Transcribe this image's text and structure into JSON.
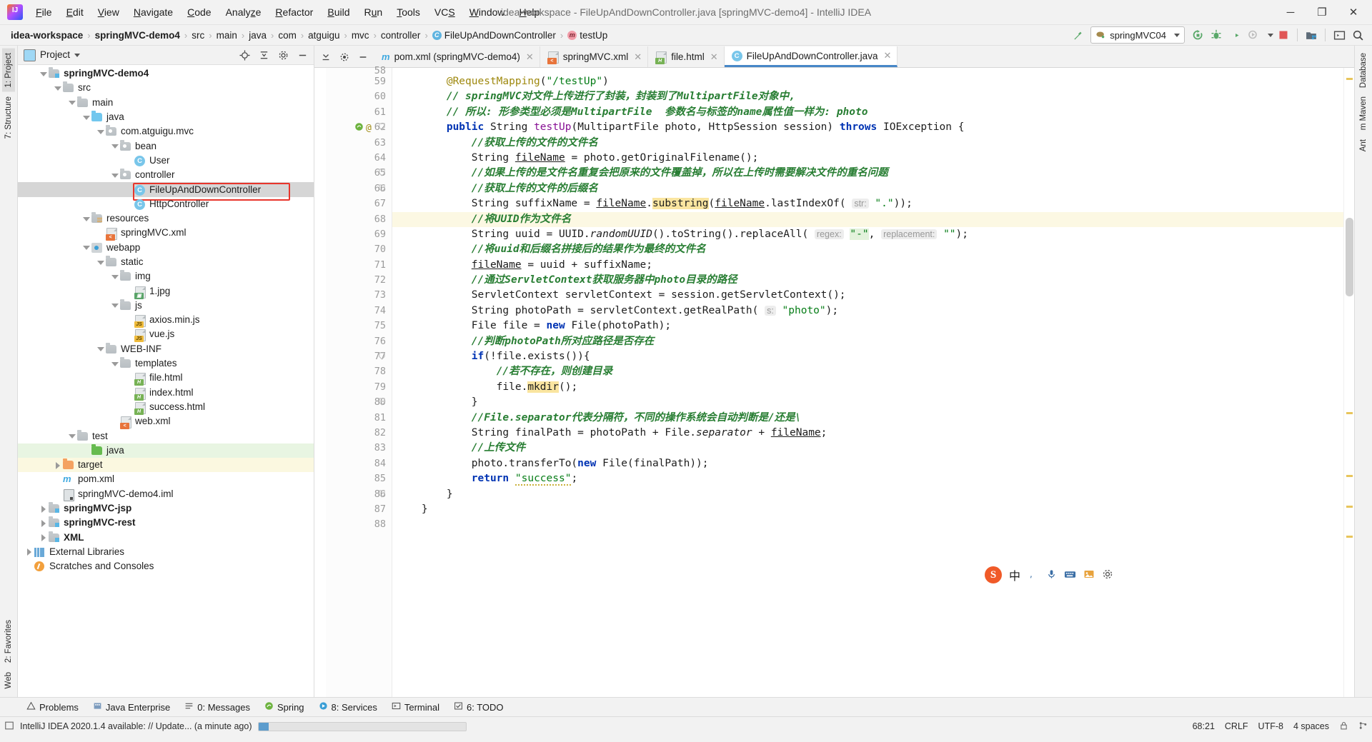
{
  "titlebar": {
    "window_title": "idea-workspace - FileUpAndDownController.java [springMVC-demo4] - IntelliJ IDEA",
    "logo": "intellij-idea-logo",
    "menu": [
      "File",
      "Edit",
      "View",
      "Navigate",
      "Code",
      "Analyze",
      "Refactor",
      "Build",
      "Run",
      "Tools",
      "VCS",
      "Window",
      "Help"
    ],
    "minimize": "─",
    "maximize": "❐",
    "close": "✕"
  },
  "navbar": {
    "crumbs": [
      {
        "label": "idea-workspace",
        "bold": true,
        "icon": ""
      },
      {
        "label": "springMVC-demo4",
        "bold": true,
        "icon": ""
      },
      {
        "label": "src",
        "bold": false,
        "icon": ""
      },
      {
        "label": "main",
        "bold": false,
        "icon": ""
      },
      {
        "label": "java",
        "bold": false,
        "icon": ""
      },
      {
        "label": "com",
        "bold": false,
        "icon": ""
      },
      {
        "label": "atguigu",
        "bold": false,
        "icon": ""
      },
      {
        "label": "mvc",
        "bold": false,
        "icon": ""
      },
      {
        "label": "controller",
        "bold": false,
        "icon": ""
      },
      {
        "label": "FileUpAndDownController",
        "bold": false,
        "icon": "class"
      },
      {
        "label": "testUp",
        "bold": false,
        "icon": "method"
      }
    ],
    "separator": "›",
    "run_config": "springMVC04",
    "icons": [
      "build-hammer-icon",
      "run-config-selector",
      "run-icon",
      "debug-icon",
      "run-with-coverage-icon",
      "profiler-icon",
      "stop-icon",
      "project-structure-icon",
      "terminal-icon",
      "search-everywhere-icon"
    ]
  },
  "left_rail": {
    "top": [
      {
        "label": "1: Project",
        "selected": true
      },
      {
        "label": "7: Structure",
        "selected": false
      }
    ],
    "bottom": [
      {
        "label": "2: Favorites",
        "selected": false
      },
      {
        "label": "Web",
        "selected": false
      }
    ]
  },
  "right_rail": {
    "items": [
      "Database",
      "m Maven",
      "Ant"
    ]
  },
  "project_panel": {
    "title": "Project",
    "header_icons": [
      "locate-icon",
      "collapse-all-icon",
      "settings-gear-icon",
      "hide-icon"
    ],
    "tree": [
      {
        "depth": 1,
        "arrow": "down",
        "icon": "module",
        "label": "springMVC-demo4",
        "bold": true,
        "state": "normal"
      },
      {
        "depth": 2,
        "arrow": "down",
        "icon": "folder-grey",
        "label": "src",
        "bold": false,
        "state": "normal"
      },
      {
        "depth": 3,
        "arrow": "down",
        "icon": "folder-grey",
        "label": "main",
        "bold": false,
        "state": "normal"
      },
      {
        "depth": 4,
        "arrow": "down",
        "icon": "folder-blue",
        "label": "java",
        "bold": false,
        "state": "normal"
      },
      {
        "depth": 5,
        "arrow": "down",
        "icon": "package",
        "label": "com.atguigu.mvc",
        "bold": false,
        "state": "normal"
      },
      {
        "depth": 6,
        "arrow": "down",
        "icon": "package",
        "label": "bean",
        "bold": false,
        "state": "normal"
      },
      {
        "depth": 7,
        "arrow": "none",
        "icon": "class",
        "label": "User",
        "bold": false,
        "state": "normal"
      },
      {
        "depth": 6,
        "arrow": "down",
        "icon": "package",
        "label": "controller",
        "bold": false,
        "state": "normal"
      },
      {
        "depth": 7,
        "arrow": "none",
        "icon": "class",
        "label": "FileUpAndDownController",
        "bold": false,
        "state": "selected"
      },
      {
        "depth": 7,
        "arrow": "none",
        "icon": "class",
        "label": "HttpController",
        "bold": false,
        "state": "normal"
      },
      {
        "depth": 4,
        "arrow": "down",
        "icon": "folder-resources",
        "label": "resources",
        "bold": false,
        "state": "normal"
      },
      {
        "depth": 5,
        "arrow": "none",
        "icon": "xml",
        "label": "springMVC.xml",
        "bold": false,
        "state": "normal"
      },
      {
        "depth": 4,
        "arrow": "down",
        "icon": "webapp",
        "label": "webapp",
        "bold": false,
        "state": "normal"
      },
      {
        "depth": 5,
        "arrow": "down",
        "icon": "folder-grey",
        "label": "static",
        "bold": false,
        "state": "normal"
      },
      {
        "depth": 6,
        "arrow": "down",
        "icon": "folder-grey",
        "label": "img",
        "bold": false,
        "state": "normal"
      },
      {
        "depth": 7,
        "arrow": "none",
        "icon": "image",
        "label": "1.jpg",
        "bold": false,
        "state": "normal"
      },
      {
        "depth": 6,
        "arrow": "down",
        "icon": "folder-grey",
        "label": "js",
        "bold": false,
        "state": "normal"
      },
      {
        "depth": 7,
        "arrow": "none",
        "icon": "js-min",
        "label": "axios.min.js",
        "bold": false,
        "state": "normal"
      },
      {
        "depth": 7,
        "arrow": "none",
        "icon": "js",
        "label": "vue.js",
        "bold": false,
        "state": "normal"
      },
      {
        "depth": 5,
        "arrow": "down",
        "icon": "folder-grey",
        "label": "WEB-INF",
        "bold": false,
        "state": "normal"
      },
      {
        "depth": 6,
        "arrow": "down",
        "icon": "folder-grey",
        "label": "templates",
        "bold": false,
        "state": "normal"
      },
      {
        "depth": 7,
        "arrow": "none",
        "icon": "html",
        "label": "file.html",
        "bold": false,
        "state": "normal"
      },
      {
        "depth": 7,
        "arrow": "none",
        "icon": "html",
        "label": "index.html",
        "bold": false,
        "state": "normal"
      },
      {
        "depth": 7,
        "arrow": "none",
        "icon": "html",
        "label": "success.html",
        "bold": false,
        "state": "normal"
      },
      {
        "depth": 6,
        "arrow": "none",
        "icon": "xml-web",
        "label": "web.xml",
        "bold": false,
        "state": "normal"
      },
      {
        "depth": 3,
        "arrow": "down",
        "icon": "folder-grey",
        "label": "test",
        "bold": false,
        "state": "normal"
      },
      {
        "depth": 4,
        "arrow": "none",
        "icon": "folder-green",
        "label": "java",
        "bold": false,
        "state": "green"
      },
      {
        "depth": 2,
        "arrow": "right",
        "icon": "folder-orange",
        "label": "target",
        "bold": false,
        "state": "yellow"
      },
      {
        "depth": 2,
        "arrow": "none",
        "icon": "maven",
        "label": "pom.xml",
        "bold": false,
        "state": "normal"
      },
      {
        "depth": 2,
        "arrow": "none",
        "icon": "iml",
        "label": "springMVC-demo4.iml",
        "bold": false,
        "state": "normal"
      },
      {
        "depth": 1,
        "arrow": "right",
        "icon": "module",
        "label": "springMVC-jsp",
        "bold": true,
        "state": "normal"
      },
      {
        "depth": 1,
        "arrow": "right",
        "icon": "module",
        "label": "springMVC-rest",
        "bold": true,
        "state": "normal"
      },
      {
        "depth": 1,
        "arrow": "right",
        "icon": "module",
        "label": "XML",
        "bold": true,
        "state": "normal"
      },
      {
        "depth": 0,
        "arrow": "right",
        "icon": "library",
        "label": "External Libraries",
        "bold": false,
        "state": "normal"
      },
      {
        "depth": 0,
        "arrow": "none",
        "icon": "scratch",
        "label": "Scratches and Consoles",
        "bold": false,
        "state": "normal"
      }
    ]
  },
  "editor": {
    "tabs": [
      {
        "label": "pom.xml (springMVC-demo4)",
        "icon": "maven-icon",
        "active": false
      },
      {
        "label": "springMVC.xml",
        "icon": "xml-icon",
        "active": false
      },
      {
        "label": "file.html",
        "icon": "html-icon",
        "active": false
      },
      {
        "label": "FileUpAndDownController.java",
        "icon": "class-icon",
        "active": true
      }
    ],
    "tab_close": "✕",
    "tool_icons": [
      "collapse-all-icon",
      "settings-icon",
      "hide-icon"
    ],
    "first_line": 58,
    "lines": [
      {
        "n": 59,
        "html": "        <span class='ann'>@RequestMapping</span>(<span class='str'>\"/testUp\"</span>)"
      },
      {
        "n": 60,
        "html": "        <span class='cmt-zh'>// springMVC对文件上传进行了封装，封装到了MultipartFile对象中,</span>"
      },
      {
        "n": 61,
        "html": "        <span class='cmt-zh'>// 所以: 形参类型必须是MultipartFile  参数名与标签的name属性值一样为: photo</span>"
      },
      {
        "n": 62,
        "html": "        <span class='kw'>public</span> String <span class='fld'>testUp</span>(MultipartFile photo, HttpSession session) <span class='kw'>throws</span> IOException {"
      },
      {
        "n": 63,
        "html": "            <span class='cmt-zh'>//获取上传的文件的文件名</span>"
      },
      {
        "n": 64,
        "html": "            String <span class='fieldu'>fileName</span> = photo.getOriginalFilename();"
      },
      {
        "n": 65,
        "html": "            <span class='cmt-zh'>//如果上传的是文件名重复会把原来的文件覆盖掉，所以在上传时需要解决文件的重名问题</span>"
      },
      {
        "n": 66,
        "html": "            <span class='cmt-zh'>//获取上传的文件的后缀名</span>"
      },
      {
        "n": 67,
        "html": "            String suffixName = <span class='fieldu'>fileName</span>.<span class='searchhl'>substring</span>(<span class='fieldu'>fileName</span>.lastIndexOf( <span class='hint'>str:</span> <span class='str'>\".\"</span>));"
      },
      {
        "n": 68,
        "html": "            <span class='cmt-zh'>//将UUID作为文件名</span>",
        "hl": true
      },
      {
        "n": 69,
        "html": "            String uuid = UUID.<span class='ital'>randomUUID</span>().toString().replaceAll( <span class='hint'>regex:</span> <span class='str strhl'>\"-\"</span>, <span class='hint'>replacement:</span> <span class='str'>\"\"</span>);"
      },
      {
        "n": 70,
        "html": "            <span class='cmt-zh'>//将uuid和后缀名拼接后的结果作为最终的文件名</span>"
      },
      {
        "n": 71,
        "html": "            <span class='fieldu'>fileName</span> = uuid + suffixName;"
      },
      {
        "n": 72,
        "html": "            <span class='cmt-zh'>//通过ServletContext获取服务器中photo目录的路径</span>"
      },
      {
        "n": 73,
        "html": "            ServletContext servletContext = session.getServletContext();"
      },
      {
        "n": 74,
        "html": "            String photoPath = servletContext.getRealPath( <span class='hint'>s:</span> <span class='str'>\"photo\"</span>);"
      },
      {
        "n": 75,
        "html": "            File file = <span class='kw'>new</span> File(photoPath);"
      },
      {
        "n": 76,
        "html": "            <span class='cmt-zh'>//判断photoPath所对应路径是否存在</span>"
      },
      {
        "n": 77,
        "html": "            <span class='kw'>if</span>(!file.exists()){"
      },
      {
        "n": 78,
        "html": "                <span class='cmt-zh'>//若不存在，则创建目录</span>"
      },
      {
        "n": 79,
        "html": "                file.<span class='searchhl'>mkdir</span>();"
      },
      {
        "n": 80,
        "html": "            }"
      },
      {
        "n": 81,
        "html": "            <span class='cmt-zh'>//File.separator代表分隔符，不同的操作系统会自动判断是/还是\\</span>"
      },
      {
        "n": 82,
        "html": "            String finalPath = photoPath + File.<span class='ital'>separator</span> + <span class='fieldu'>fileName</span>;"
      },
      {
        "n": 83,
        "html": "            <span class='cmt-zh'>//上传文件</span>"
      },
      {
        "n": 84,
        "html": "            photo.transferTo(<span class='kw'>new</span> File(finalPath));"
      },
      {
        "n": 85,
        "html": "            <span class='kw'>return</span> <span class='str warn-squiggle'>\"success\"</span>;"
      },
      {
        "n": 86,
        "html": "        }"
      },
      {
        "n": 87,
        "html": "    }"
      },
      {
        "n": 88,
        "html": ""
      }
    ]
  },
  "bottom_tabs": [
    {
      "label": "Problems",
      "icon": "warning-icon"
    },
    {
      "label": "Java Enterprise",
      "icon": "enterprise-icon"
    },
    {
      "label": "0: Messages",
      "icon": "messages-icon"
    },
    {
      "label": "Spring",
      "icon": "spring-leaf-icon"
    },
    {
      "label": "8: Services",
      "icon": "services-icon"
    },
    {
      "label": "Terminal",
      "icon": "terminal-icon"
    },
    {
      "label": "6: TODO",
      "icon": "todo-icon"
    }
  ],
  "statusbar": {
    "message": "IntelliJ IDEA 2020.1.4 available: // Update... (a minute ago)",
    "caret": "68:21",
    "line_sep": "CRLF",
    "encoding": "UTF-8",
    "indent": "4 spaces",
    "ime_lang": "中",
    "tray_icons": [
      "sogou-ime-icon",
      "language-icon",
      "keyboard-icon",
      "microphone-icon",
      "grid-icon",
      "image-icon",
      "gear-icon"
    ],
    "progress_percent": 5
  },
  "colors": {
    "accent_blue": "#4787c7",
    "selection_grey": "#d6d6d6",
    "highlight_red": "#e8362c",
    "green_row": "#e8f5e2",
    "yellow_row": "#fbf8e0",
    "comment_green": "#287e33",
    "keyword_blue": "#0033b3",
    "string_green": "#067d17"
  }
}
